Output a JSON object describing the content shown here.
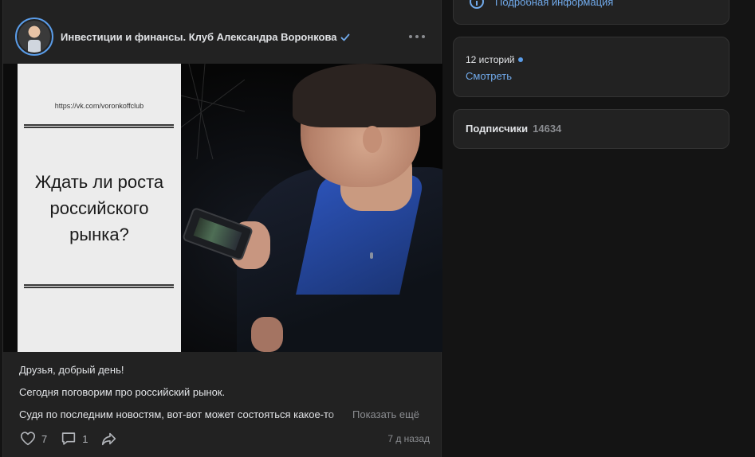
{
  "post": {
    "author": "Инвестиции и финансы. Клуб Александра Воронкова",
    "image": {
      "url_text": "https://vk.com/voronkoffclub",
      "title_lines": [
        "Ждать ли роста",
        "российского",
        "рынка?"
      ]
    },
    "text": {
      "line1": "Друзья, добрый день!",
      "line2": "Сегодня поговорим про российский рынок.",
      "line3": "Судя по последним новостям, вот-вот может состояться какое-то",
      "show_more": "Показать ещё"
    },
    "likes": "7",
    "comments": "1",
    "date": "7 д назад"
  },
  "sidebar": {
    "info_link": "Подробная информация",
    "stories_title": "12 историй",
    "stories_link": "Смотреть",
    "subscribers_label": "Подписчики",
    "subscribers_count": "14634"
  },
  "icons": {
    "verified": "check-icon",
    "more": "more-icon",
    "like": "heart-icon",
    "comment": "comment-icon",
    "share": "share-icon",
    "info": "info-icon"
  },
  "colors": {
    "accent": "#71aaeb",
    "background": "#141414",
    "card": "#222222"
  }
}
